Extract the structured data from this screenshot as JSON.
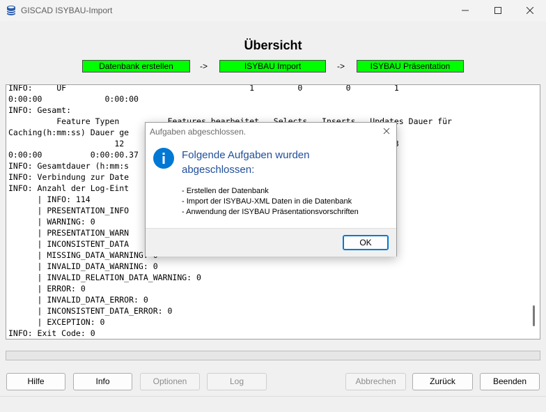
{
  "window": {
    "title": "GISCAD ISYBAU-Import",
    "icon": "database-icon"
  },
  "header": {
    "title": "Übersicht"
  },
  "steps": [
    {
      "label": "Datenbank erstellen",
      "color": "#00ff00"
    },
    {
      "label": "ISYBAU Import",
      "color": "#00ff00"
    },
    {
      "label": "ISYBAU Präsentation",
      "color": "#00ff00"
    }
  ],
  "arrows": [
    "->",
    "->"
  ],
  "log": {
    "lines": [
      "INFO:     UF                                      1         0         0         1",
      "0:00:00             0:00:00",
      "INFO: Gesamt:",
      "          Feature Typen          Features bearbeitet   Selects   Inserts   Updates Dauer für",
      "Caching(h:mm:ss) Dauer ge",
      "                      12                                                      343",
      "0:00:00          0:00:00.37",
      "INFO: Gesamtdauer (h:mm:s",
      "INFO: Verbindung zur Date",
      "INFO: Anzahl der Log-Eint",
      "      | INFO: 114",
      "      | PRESENTATION_INFO",
      "      | WARNING: 0",
      "      | PRESENTATION_WARN",
      "      | INCONSISTENT_DATA",
      "      | MISSING_DATA_WARNING: 0",
      "      | INVALID_DATA_WARNING: 0",
      "      | INVALID_RELATION_DATA_WARNING: 0",
      "      | ERROR: 0",
      "      | INVALID_DATA_ERROR: 0",
      "      | INCONSISTENT_DATA_ERROR: 0",
      "      | EXCEPTION: 0",
      "INFO: Exit Code: 0"
    ]
  },
  "buttons": {
    "hilfe": "Hilfe",
    "info": "Info",
    "optionen": "Optionen",
    "log": "Log",
    "abbrechen": "Abbrechen",
    "zurueck": "Zurück",
    "beenden": "Beenden"
  },
  "dialog": {
    "title": "Aufgaben abgeschlossen.",
    "headline": "Folgende Aufgaben wurden abgeschlossen:",
    "items": [
      "- Erstellen der Datenbank",
      "- Import der ISYBAU-XML Daten in die Datenbank",
      "- Anwendung der ISYBAU Präsentationsvorschriften"
    ],
    "ok": "OK",
    "icon": "info-icon",
    "accent": "#0078d4"
  }
}
